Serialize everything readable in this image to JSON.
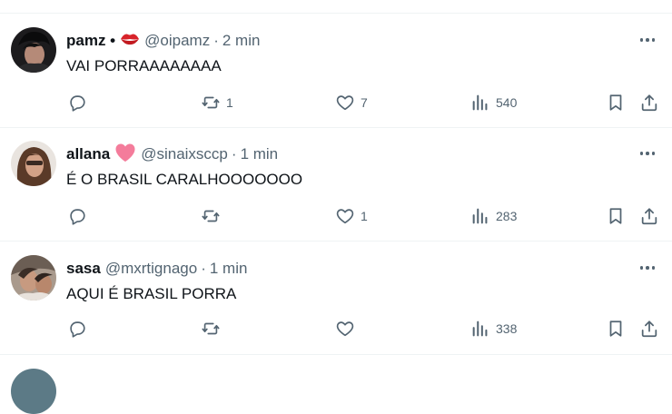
{
  "tweets": [
    {
      "name": "pamz •",
      "emoji": "kiss-lips-icon",
      "handle": "@oipamz",
      "time": "2 min",
      "text": "VAI PORRAAAAAAAA",
      "replies": "",
      "retweets": "1",
      "likes": "7",
      "views": "540"
    },
    {
      "name": "allana",
      "emoji": "pink-heart-icon",
      "handle": "@sinaixsccp",
      "time": "1 min",
      "text": "É O BRASIL CARALHOOOOOOO",
      "replies": "",
      "retweets": "",
      "likes": "1",
      "views": "283"
    },
    {
      "name": "sasa",
      "emoji": "",
      "handle": "@mxrtignago",
      "time": "1 min",
      "text": "AQUI É BRASIL PORRA",
      "replies": "",
      "retweets": "",
      "likes": "",
      "views": "338"
    }
  ],
  "colors": {
    "text": "#0f1419",
    "secondary": "#536471",
    "divider": "#eff3f4",
    "heart_emoji": "#f47c9b",
    "lips_emoji": "#d8232a"
  }
}
